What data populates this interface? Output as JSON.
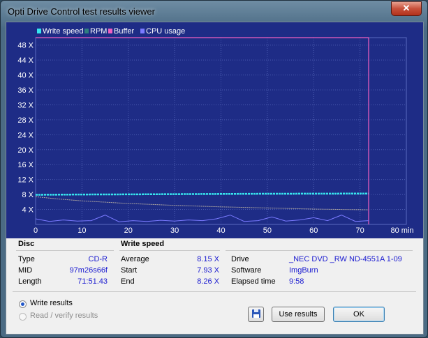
{
  "window": {
    "title": "Opti Drive Control test results viewer",
    "close_label": "✕"
  },
  "chart_data": {
    "type": "line",
    "legend": [
      "Write speed",
      "RPM",
      "Buffer",
      "CPU usage"
    ],
    "legend_placement": "top-left",
    "y_ticks": [
      "4 X",
      "8 X",
      "12 X",
      "16 X",
      "20 X",
      "24 X",
      "28 X",
      "32 X",
      "36 X",
      "40 X",
      "44 X",
      "48 X"
    ],
    "x_ticks": [
      "0",
      "10",
      "20",
      "30",
      "40",
      "50",
      "60",
      "70",
      "80 min"
    ],
    "xlim": [
      0,
      80
    ],
    "ylim": [
      0,
      50
    ],
    "grid": true,
    "colors": {
      "write_speed": "#36e6ee",
      "rpm": "#2f7f7f",
      "buffer": "#f060c0",
      "cpu": "#7a7aff",
      "plot_bg": "#1e2c86",
      "grid": "#4a5ab0"
    },
    "series": [
      {
        "name": "Write speed",
        "x": [
          0,
          10,
          20,
          30,
          40,
          50,
          60,
          71.86
        ],
        "y": [
          7.93,
          8.0,
          8.05,
          8.1,
          8.15,
          8.2,
          8.22,
          8.26
        ]
      },
      {
        "name": "RPM",
        "x": [
          0,
          5,
          10,
          20,
          30,
          40,
          50,
          60,
          71.86
        ],
        "y": [
          7.4,
          6.8,
          6.3,
          5.6,
          5.1,
          4.7,
          4.4,
          4.1,
          3.9
        ]
      },
      {
        "name": "Buffer",
        "x": [
          0,
          71.86
        ],
        "y": [
          50,
          50
        ]
      },
      {
        "name": "CPU usage",
        "x": [
          0,
          3,
          6,
          9,
          12,
          15,
          18,
          21,
          24,
          27,
          30,
          33,
          36,
          39,
          42,
          45,
          48,
          51,
          54,
          57,
          60,
          63,
          66,
          69,
          71.86
        ],
        "y": [
          1.5,
          0.8,
          1.2,
          0.9,
          1.0,
          2.5,
          0.7,
          1.0,
          0.8,
          1.1,
          0.9,
          1.2,
          1.0,
          1.5,
          2.5,
          0.8,
          1.0,
          2.0,
          0.9,
          1.2,
          1.8,
          1.0,
          2.5,
          0.8,
          1.0
        ]
      }
    ]
  },
  "disc": {
    "title": "Disc",
    "rows": [
      {
        "label": "Type",
        "value": "CD-R"
      },
      {
        "label": "MID",
        "value": "97m26s66f"
      },
      {
        "label": "Length",
        "value": "71:51.43"
      }
    ]
  },
  "write_speed": {
    "title": "Write speed",
    "rows": [
      {
        "label": "Average",
        "value": "8.15 X"
      },
      {
        "label": "Start",
        "value": "7.93 X"
      },
      {
        "label": "End",
        "value": "8.26 X"
      }
    ]
  },
  "drive": {
    "rows": [
      {
        "label": "Drive",
        "value": "_NEC DVD _RW ND-4551A 1-09"
      },
      {
        "label": "Software",
        "value": "ImgBurn"
      },
      {
        "label": "Elapsed time",
        "value": "9:58"
      }
    ]
  },
  "options": {
    "write_results": "Write results",
    "read_verify_results": "Read / verify results"
  },
  "buttons": {
    "use_results": "Use results",
    "ok": "OK"
  }
}
